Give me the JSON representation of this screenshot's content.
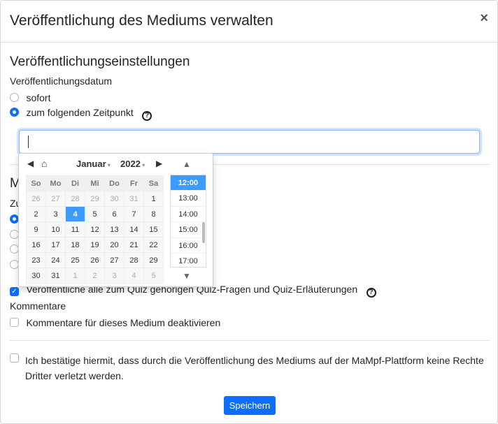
{
  "modal": {
    "title": "Veröffentlichung des Mediums verwalten",
    "close": "×"
  },
  "settings": {
    "section_title": "Veröffentlichungseinstellungen",
    "date_label": "Veröffentlichungsdatum",
    "option_immediately": "sofort",
    "option_scheduled": "zum folgenden Zeitpunkt",
    "date_value": ""
  },
  "hidden_section": {
    "heading_partial": "M",
    "label_partial": "Zu",
    "quiz_checkbox_label": "Veröffentliche alle zum Quiz gehörigen Quiz-Fragen und Quiz-Erläuterungen"
  },
  "comments": {
    "label": "Kommentare",
    "checkbox_label": "Kommentare für dieses Medium deaktivieren"
  },
  "confirm": {
    "text": "Ich bestätige hiermit, dass durch die Veröffentlichung des Mediums auf der MaMpf-Plattform keine Rechte Dritter verletzt werden."
  },
  "save_label": "Speichern",
  "picker": {
    "month": "Januar",
    "year": "2022",
    "weekdays": [
      "So",
      "Mo",
      "Di",
      "Mi",
      "Do",
      "Fr",
      "Sa"
    ],
    "weeks": [
      [
        "26",
        "27",
        "28",
        "29",
        "30",
        "31",
        "1"
      ],
      [
        "2",
        "3",
        "4",
        "5",
        "6",
        "7",
        "8"
      ],
      [
        "9",
        "10",
        "11",
        "12",
        "13",
        "14",
        "15"
      ],
      [
        "16",
        "17",
        "18",
        "19",
        "20",
        "21",
        "22"
      ],
      [
        "23",
        "24",
        "25",
        "26",
        "27",
        "28",
        "29"
      ],
      [
        "30",
        "31",
        "1",
        "2",
        "3",
        "4",
        "5"
      ]
    ],
    "selected_day": "4",
    "times": [
      "12:00",
      "13:00",
      "14:00",
      "15:00",
      "16:00",
      "17:00"
    ],
    "selected_time": "12:00"
  },
  "colors": {
    "primary": "#0d6efd",
    "highlight": "#3d9bff"
  }
}
